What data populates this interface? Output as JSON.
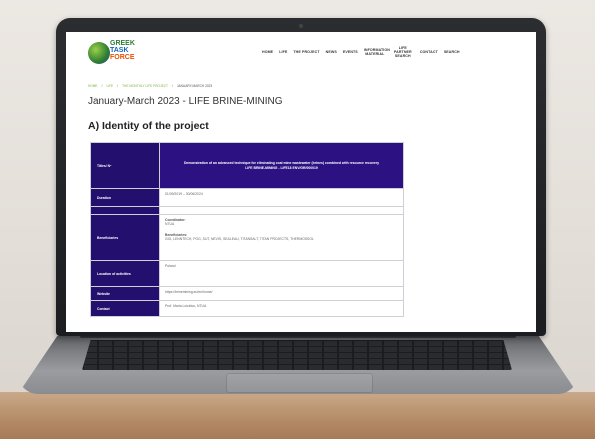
{
  "site": {
    "logo_lines": [
      "GREEK",
      "TASK",
      "FORCE"
    ],
    "nav": [
      "HOME",
      "LIFE",
      "THE PROJECT",
      "NEWS",
      "EVENTS",
      "INFORMATION MATERIAL",
      "LIFE PARTNER SEARCH",
      "CONTACT",
      "SEARCH"
    ]
  },
  "breadcrumb": [
    "HOME",
    "LIFE",
    "THE MONTHLY LIFE PROJECT",
    "JANUARY-MARCH 2023"
  ],
  "page_title": "January-March 2023 - LIFE BRINE-MINING",
  "section_title": "A) Identity of the project",
  "identity": {
    "title_label": "Titles/ Nº",
    "title_line1": "Demonstration of an advanced technique for eliminating coal mine wastewater (brines) combined with resource recovery",
    "title_line2": "LIFE BRINE-MINING - LIFE18 ENV/GR/000019",
    "duration_label": "Duration",
    "duration_value": "01/09/2019 – 30/06/2024",
    "beneficiaries_label": "Beneficiaries",
    "coordinator_label": "Coordinator:",
    "coordinator_value": "NTUA",
    "beneficiaries_sub_label": "Beneficiaries:",
    "beneficiaries_value": "GIG, LENNTECH, PGG, SUT, NEVIS, SEALEAU, TITANSALT, TITAN PROJECTS, THERMOSSOL",
    "location_label": "Location of activities",
    "location_value": "Poland",
    "website_label": "Website",
    "website_value": "https://brinemining.eu/en/home/",
    "contact_label": "Contact",
    "contact_value": "Prof. Maria Loizidou, NTUA"
  }
}
